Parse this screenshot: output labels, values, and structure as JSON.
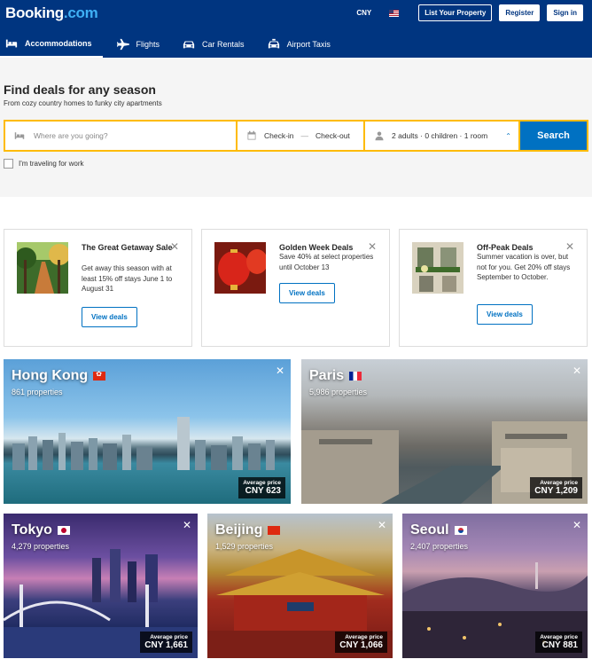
{
  "header": {
    "logo_main": "Booking",
    "logo_suffix": ".com",
    "currency": "CNY",
    "list_property": "List Your Property",
    "register": "Register",
    "sign_in": "Sign in"
  },
  "nav": [
    {
      "label": "Accommodations",
      "icon": "bed-icon",
      "active": true
    },
    {
      "label": "Flights",
      "icon": "plane-icon",
      "active": false
    },
    {
      "label": "Car Rentals",
      "icon": "car-icon",
      "active": false
    },
    {
      "label": "Airport Taxis",
      "icon": "taxi-icon",
      "active": false
    }
  ],
  "hero": {
    "title": "Find deals for any season",
    "subtitle": "From cozy country homes to funky city apartments",
    "destination_placeholder": "Where are you going?",
    "check_in": "Check-in",
    "check_out": "Check-out",
    "guests": "2 adults · 0 children · 1 room",
    "search": "Search",
    "work_travel": "I'm traveling for work"
  },
  "deals": [
    {
      "title": "The Great Getaway Sale",
      "text": "Get away this season with at least 15% off stays June 1 to August 31",
      "button": "View deals"
    },
    {
      "title": "Golden Week Deals",
      "text": "Save 40% at select properties until October 13",
      "button": "View deals"
    },
    {
      "title": "Off-Peak Deals",
      "text": "Summer vacation is over, but not for you. Get 20% off stays September to October.",
      "button": "View deals"
    }
  ],
  "destinations": [
    {
      "name": "Hong Kong",
      "properties": "861 properties",
      "price_label": "Average price",
      "price": "CNY 623"
    },
    {
      "name": "Paris",
      "properties": "5,986 properties",
      "price_label": "Average price",
      "price": "CNY 1,209"
    },
    {
      "name": "Tokyo",
      "properties": "4,279 properties",
      "price_label": "Average price",
      "price": "CNY 1,661"
    },
    {
      "name": "Beijing",
      "properties": "1,529 properties",
      "price_label": "Average price",
      "price": "CNY 1,066"
    },
    {
      "name": "Seoul",
      "properties": "2,407 properties",
      "price_label": "Average price",
      "price": "CNY 881"
    }
  ],
  "colors": {
    "brand_blue": "#003580",
    "accent_yellow": "#febb02",
    "button_blue": "#0071c2"
  }
}
